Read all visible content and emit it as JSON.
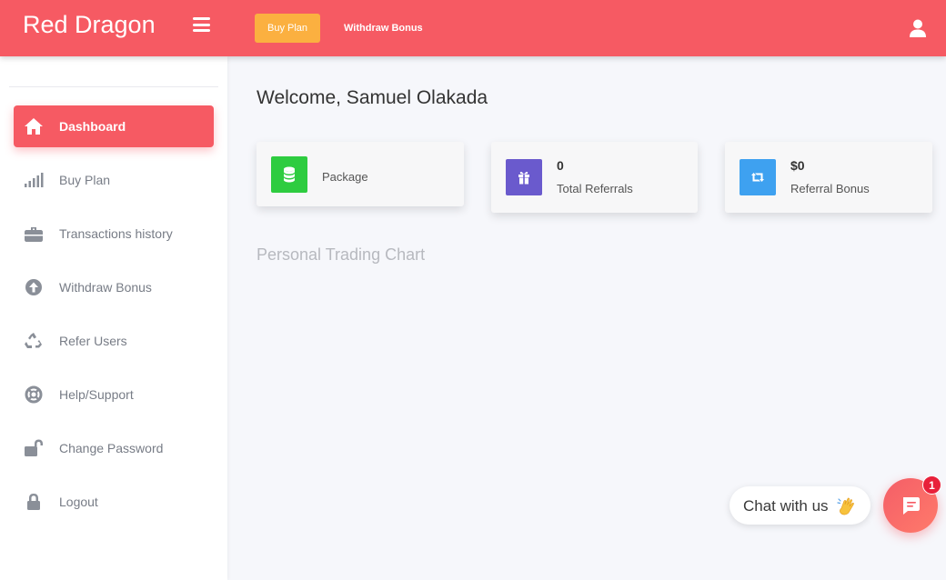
{
  "header": {
    "brand": "Red Dragon",
    "buy_plan_label": "Buy Plan",
    "withdraw_bonus_label": "Withdraw Bonus"
  },
  "sidebar": {
    "items": [
      {
        "label": "Dashboard",
        "icon": "home-icon",
        "active": true
      },
      {
        "label": "Buy Plan",
        "icon": "signal-bars-icon"
      },
      {
        "label": "Transactions history",
        "icon": "briefcase-icon"
      },
      {
        "label": "Withdraw Bonus",
        "icon": "arrow-up-circle-icon"
      },
      {
        "label": "Refer Users",
        "icon": "recycle-icon"
      },
      {
        "label": "Help/Support",
        "icon": "life-ring-icon"
      },
      {
        "label": "Change Password",
        "icon": "unlock-icon"
      },
      {
        "label": "Logout",
        "icon": "lock-icon"
      }
    ]
  },
  "main": {
    "welcome": "Welcome, Samuel Olakada",
    "cards": [
      {
        "value": "",
        "caption": "Package",
        "icon": "coins-icon",
        "color": "#2ecc40"
      },
      {
        "value": "0",
        "caption": "Total Referrals",
        "icon": "gift-icon",
        "color": "#6a5acd"
      },
      {
        "value": "$0",
        "caption": "Referral Bonus",
        "icon": "retweet-icon",
        "color": "#3ea1f0"
      }
    ],
    "chart_title": "Personal Trading Chart"
  },
  "chat": {
    "prompt": "Chat with us",
    "badge_count": "1"
  },
  "colors": {
    "primary": "#f65a63",
    "buy_button": "#fbb040"
  }
}
